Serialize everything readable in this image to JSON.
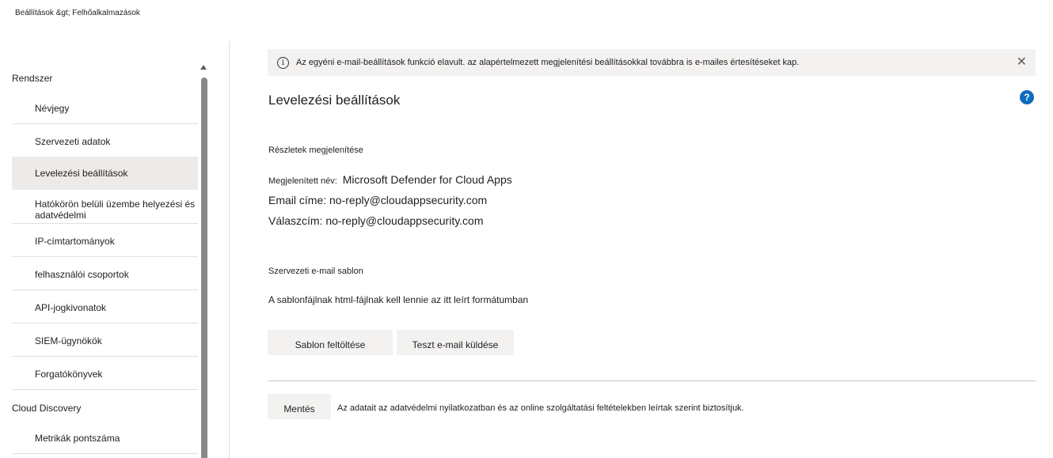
{
  "breadcrumb": "Beállítások &gt; Felhőalkalmazások",
  "sidebar": {
    "group_system": "Rendszer",
    "items": [
      {
        "label": "Névjegy"
      },
      {
        "label": "Szervezeti adatok"
      },
      {
        "label": "Levelezési beállítások"
      },
      {
        "label": "Hatókörön belüli üzembe helyezési és adatvédelmi"
      },
      {
        "label": "IP-címtartományok"
      },
      {
        "label": "felhasználói csoportok"
      },
      {
        "label": "API-jogkivonatok"
      },
      {
        "label": "SIEM-ügynökök"
      },
      {
        "label": "Forgatókönyvek"
      }
    ],
    "group_discovery": "Cloud Discovery",
    "discovery_items": [
      {
        "label": "Metrikák pontszáma"
      }
    ]
  },
  "banner": {
    "icon": "info-icon",
    "message": "Az egyéni e-mail-beállítások funkció elavult. az alapértelmezett megjelenítési beállításokkal továbbra is e-mailes értesítéseket kap.",
    "close": "✕"
  },
  "main": {
    "title": "Levelezési beállítások",
    "help": "?",
    "details_heading": "Részletek megjelenítése",
    "display_name_label": "Megjelenített név:",
    "display_name_value": "Microsoft Defender for Cloud Apps",
    "email_line": "Email címe: no-reply@cloudappsecurity.com",
    "reply_line": "Válaszcím: no-reply@cloudappsecurity.com",
    "template_heading": "Szervezeti e-mail sablon",
    "template_note": "A sablonfájlnak html-fájlnak kell lennie az itt leírt formátumban",
    "upload_button": "Sablon feltöltése",
    "test_button": "Teszt e-mail küldése",
    "save_button": "Mentés",
    "save_note": "Az adatait az adatvédelmi nyilatkozatban és az online szolgáltatási feltételekben leírtak szerint biztosítjuk."
  }
}
